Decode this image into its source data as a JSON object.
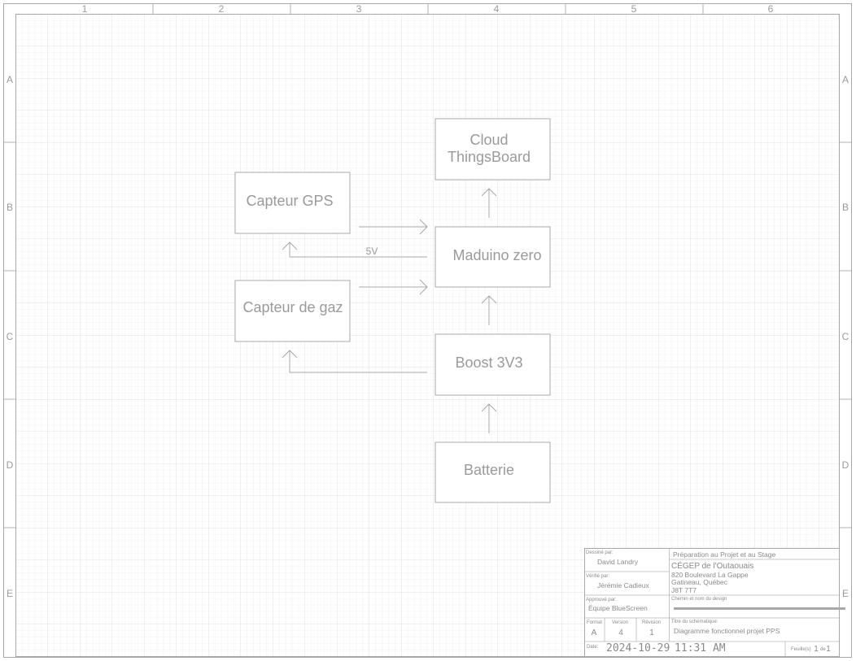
{
  "sheet": {
    "columns": [
      "1",
      "2",
      "3",
      "4",
      "5",
      "6"
    ],
    "rows": [
      "A",
      "B",
      "C",
      "D",
      "E"
    ],
    "colors": {
      "line": "#a8a8a8",
      "grid": "#ececec",
      "text": "#9a9a9a"
    }
  },
  "diagram": {
    "blocks": {
      "cloud": {
        "line1": "Cloud",
        "line2": "ThingsBoard"
      },
      "gps": {
        "label": "Capteur GPS"
      },
      "maduino": {
        "label": "Maduino zero"
      },
      "gas": {
        "label": "Capteur de gaz"
      },
      "boost": {
        "label": "Boost 3V3"
      },
      "battery": {
        "label": "Batterie"
      }
    },
    "wires": {
      "power_5v_label": "5V"
    }
  },
  "title_block": {
    "drawn_by_caption": "Dessiné par:",
    "drawn_by": "David Landry",
    "checked_by_caption": "Vérifié par:",
    "checked_by": "Jérémie Cadieux",
    "approved_by_caption": "Approuvé par:",
    "approved_by": "Équipe BlueScreen",
    "format_caption": "Format",
    "format": "A",
    "version_caption": "Version",
    "version": "4",
    "revision_caption": "Révision",
    "revision": "1",
    "date_caption": "Date:",
    "date": "2024-10-29",
    "time": "11:31 AM",
    "project": "Préparation au Projet et au Stage",
    "org_name": "CÉGEP de l'Outaouais",
    "address1": "820 Boulevard La Gappe",
    "address2": "Gatineau, Québec",
    "postal": "J8T 7T7",
    "path_caption": "Chemin et nom du design",
    "schematic_title_caption": "Titre du schématique:",
    "schematic_title": "Diagramme fonctionnel projet PPS",
    "sheet_caption": "Feuille(s)",
    "sheet_current": "1",
    "sheet_of": "de",
    "sheet_total": "1"
  }
}
